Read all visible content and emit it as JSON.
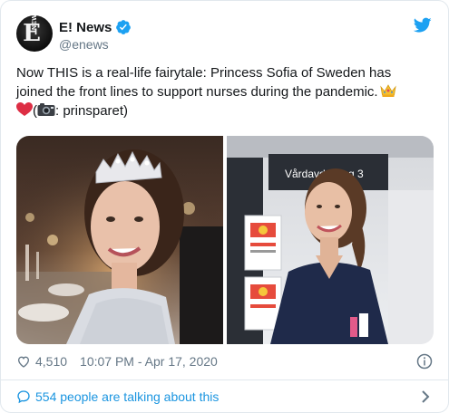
{
  "tweet": {
    "author_name": "E! News",
    "author_handle": "@enews",
    "avatar_logo_text": "E! NEWS",
    "text_line1": "Now THIS is a real-life fairytale: Princess Sofia of Sweden has",
    "text_line2": "joined the front lines to support nurses during the pandemic.",
    "text_line3_prefix": "(",
    "text_line3_suffix": ": prinsparet)",
    "emojis": [
      "crown",
      "red-heart",
      "camera"
    ],
    "photo_right_sign": "Vårdavdelning 3",
    "likes": "4,510",
    "timestamp": "10:07 PM - Apr 17, 2020",
    "talking_link": "554 people are talking about this"
  },
  "colors": {
    "text": "#14171a",
    "secondary": "#657786",
    "link": "#1b95e0",
    "border": "#e1e8ed",
    "verified": "#1da1f2"
  },
  "icons": [
    "verified-badge-icon",
    "twitter-bird-icon",
    "heart-icon",
    "info-icon",
    "speech-bubble-icon",
    "chevron-right-icon"
  ]
}
